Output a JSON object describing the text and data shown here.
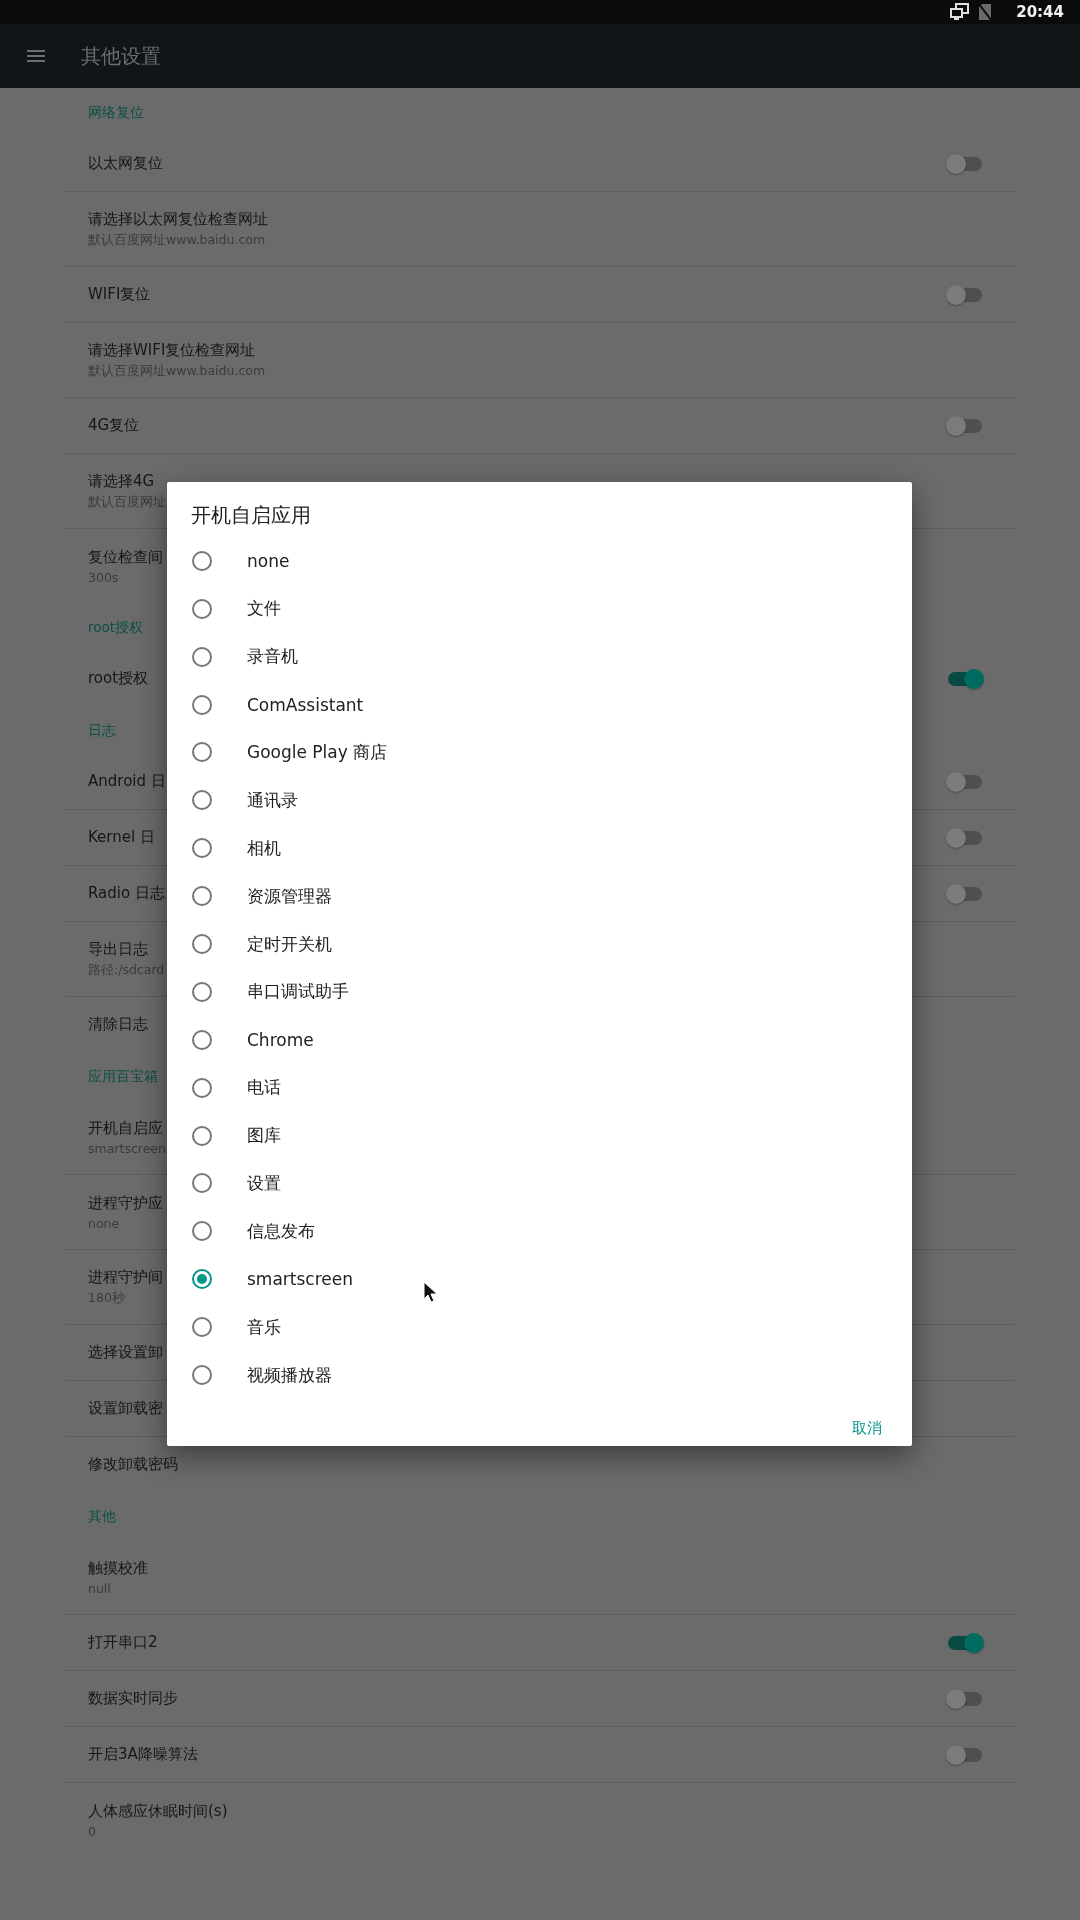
{
  "status_bar": {
    "time": "20:44"
  },
  "app_bar": {
    "title": "其他设置"
  },
  "sections": [
    {
      "header": "网络复位",
      "rows": [
        {
          "kind": "switch",
          "title": "以太网复位",
          "on": false
        },
        {
          "kind": "text",
          "title": "请选择以太网复位检查网址",
          "subtitle": "默认百度网址www.baidu.com"
        },
        {
          "kind": "switch",
          "title": "WIFI复位",
          "on": false
        },
        {
          "kind": "text",
          "title": "请选择WIFI复位检查网址",
          "subtitle": "默认百度网址www.baidu.com"
        },
        {
          "kind": "switch",
          "title": "4G复位",
          "on": false
        },
        {
          "kind": "text",
          "title": "请选择4G",
          "subtitle": "默认百度网址"
        },
        {
          "kind": "text",
          "title": "复位检查间",
          "subtitle": "300s"
        }
      ]
    },
    {
      "header": "root授权",
      "rows": [
        {
          "kind": "switch",
          "title": "root授权",
          "on": true
        }
      ]
    },
    {
      "header": "日志",
      "rows": [
        {
          "kind": "switch",
          "title": "Android 日",
          "on": false
        },
        {
          "kind": "switch",
          "title": "Kernel 日",
          "on": false
        },
        {
          "kind": "switch",
          "title": "Radio 日志",
          "on": false
        },
        {
          "kind": "text",
          "title": "导出日志",
          "subtitle": "路径:/sdcard"
        },
        {
          "kind": "text",
          "title": "清除日志"
        }
      ]
    },
    {
      "header": "应用百宝箱",
      "rows": [
        {
          "kind": "text",
          "title": "开机自启应",
          "subtitle": "smartscreen"
        },
        {
          "kind": "text",
          "title": "进程守护应",
          "subtitle": "none"
        },
        {
          "kind": "text",
          "title": "进程守护间",
          "subtitle": "180秒"
        },
        {
          "kind": "text",
          "title": "选择设置卸"
        },
        {
          "kind": "text",
          "title": "设置卸载密"
        },
        {
          "kind": "text",
          "title": "修改卸载密码"
        }
      ]
    },
    {
      "header": "其他",
      "rows": [
        {
          "kind": "text",
          "title": "触摸校准",
          "subtitle": "null"
        },
        {
          "kind": "switch",
          "title": "打开串口2",
          "on": true
        },
        {
          "kind": "switch",
          "title": "数据实时同步",
          "on": false
        },
        {
          "kind": "switch",
          "title": "开启3A降噪算法",
          "on": false
        },
        {
          "kind": "text",
          "title": "人体感应休眠时间(s)",
          "subtitle": "0"
        }
      ]
    }
  ],
  "dialog": {
    "title": "开机自启应用",
    "options": [
      {
        "label": "none",
        "selected": false
      },
      {
        "label": "文件",
        "selected": false
      },
      {
        "label": "录音机",
        "selected": false
      },
      {
        "label": "ComAssistant",
        "selected": false
      },
      {
        "label": "Google Play 商店",
        "selected": false
      },
      {
        "label": "通讯录",
        "selected": false
      },
      {
        "label": "相机",
        "selected": false
      },
      {
        "label": "资源管理器",
        "selected": false
      },
      {
        "label": "定时开关机",
        "selected": false
      },
      {
        "label": "串口调试助手",
        "selected": false
      },
      {
        "label": "Chrome",
        "selected": false
      },
      {
        "label": "电话",
        "selected": false
      },
      {
        "label": "图库",
        "selected": false
      },
      {
        "label": "设置",
        "selected": false
      },
      {
        "label": "信息发布",
        "selected": false
      },
      {
        "label": "smartscreen",
        "selected": true
      },
      {
        "label": "音乐",
        "selected": false
      },
      {
        "label": "视频播放器",
        "selected": false
      }
    ],
    "cancel": "取消"
  }
}
